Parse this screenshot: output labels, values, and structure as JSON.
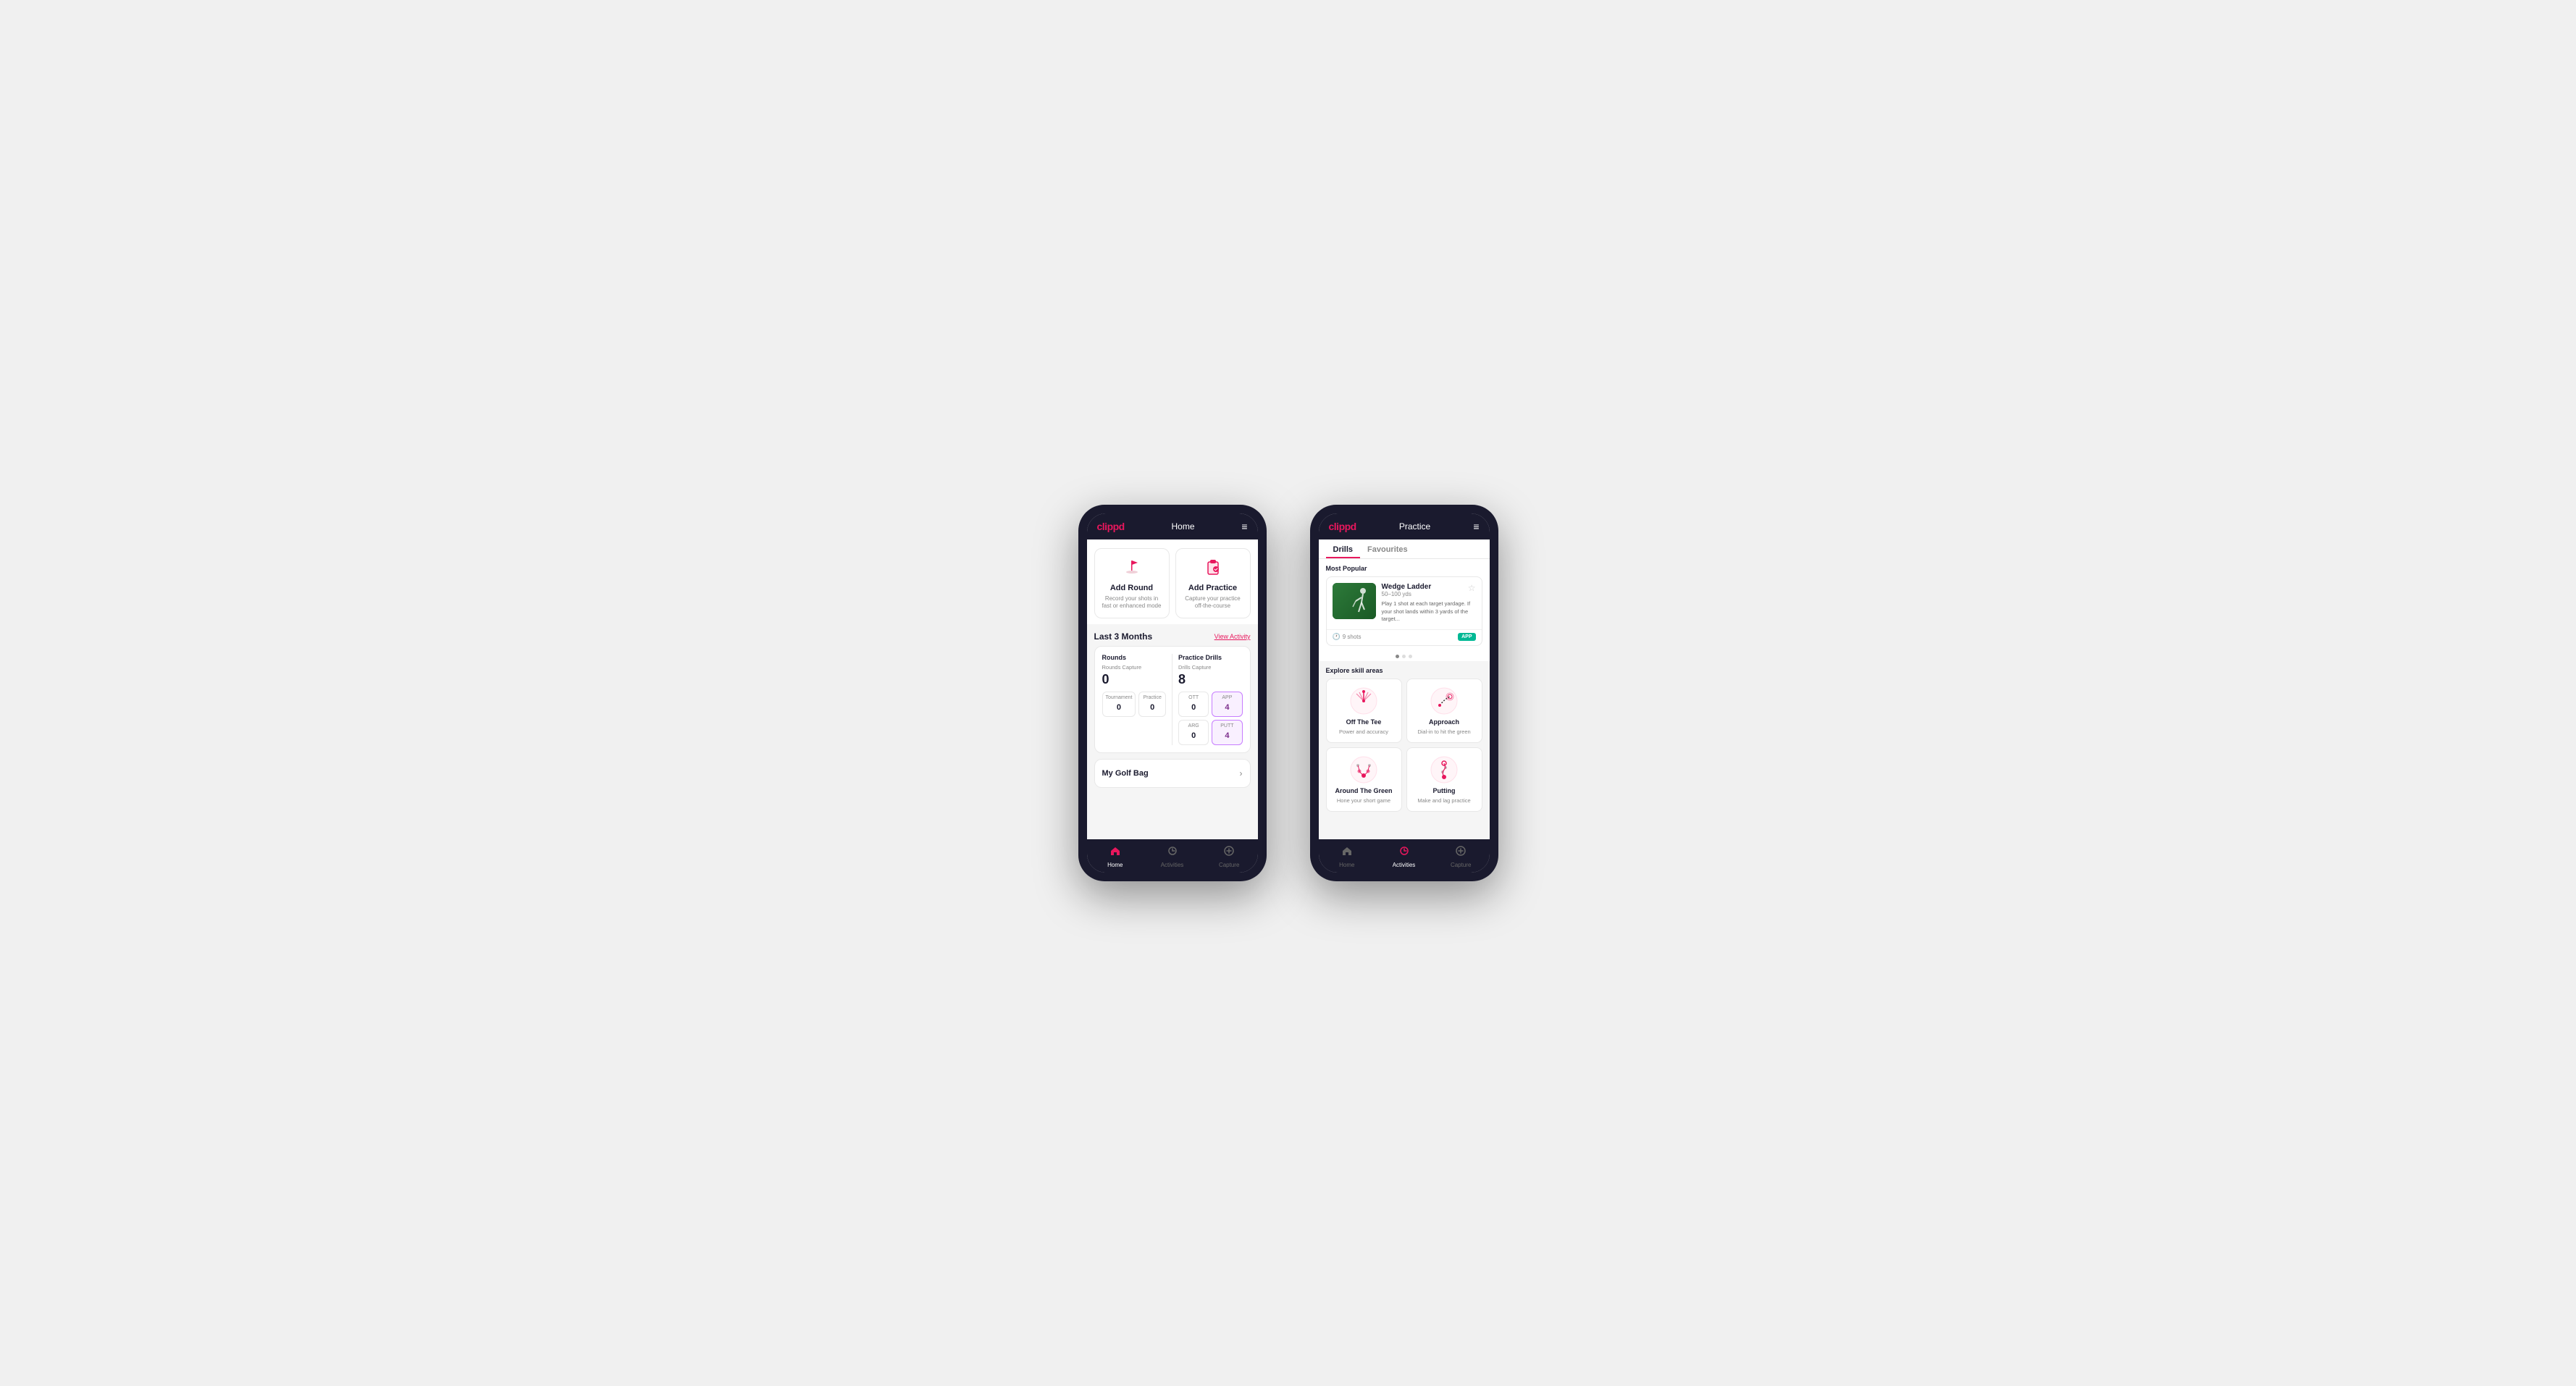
{
  "phone1": {
    "header": {
      "logo": "clippd",
      "title": "Home",
      "menu_icon": "≡"
    },
    "actions": [
      {
        "id": "add-round",
        "title": "Add Round",
        "desc": "Record your shots in fast or enhanced mode",
        "icon": "flag"
      },
      {
        "id": "add-practice",
        "title": "Add Practice",
        "desc": "Capture your practice off-the-course",
        "icon": "clipboard"
      }
    ],
    "activity": {
      "title": "Last 3 Months",
      "link": "View Activity"
    },
    "rounds": {
      "title": "Rounds",
      "capture_label": "Rounds Capture",
      "total": "0",
      "items": [
        {
          "label": "Tournament",
          "value": "0"
        },
        {
          "label": "Practice",
          "value": "0"
        }
      ]
    },
    "practice_drills": {
      "title": "Practice Drills",
      "capture_label": "Drills Capture",
      "total": "8",
      "items": [
        {
          "label": "OTT",
          "value": "0"
        },
        {
          "label": "APP",
          "value": "4",
          "highlighted": true
        },
        {
          "label": "ARG",
          "value": "0"
        },
        {
          "label": "PUTT",
          "value": "4",
          "highlighted": true
        }
      ]
    },
    "golf_bag": {
      "label": "My Golf Bag"
    },
    "nav": [
      {
        "label": "Home",
        "active": true,
        "icon": "🏠"
      },
      {
        "label": "Activities",
        "active": false,
        "icon": "⛳"
      },
      {
        "label": "Capture",
        "active": false,
        "icon": "➕"
      }
    ]
  },
  "phone2": {
    "header": {
      "logo": "clippd",
      "title": "Practice",
      "menu_icon": "≡"
    },
    "tabs": [
      {
        "label": "Drills",
        "active": true
      },
      {
        "label": "Favourites",
        "active": false
      }
    ],
    "most_popular": {
      "label": "Most Popular",
      "drill": {
        "name": "Wedge Ladder",
        "yardage": "50–100 yds",
        "desc": "Play 1 shot at each target yardage. If your shot lands within 3 yards of the target...",
        "shots": "9 shots",
        "badge": "APP"
      },
      "dots": [
        true,
        false,
        false
      ]
    },
    "skill_areas": {
      "label": "Explore skill areas",
      "items": [
        {
          "name": "Off The Tee",
          "desc": "Power and accuracy",
          "icon": "tee"
        },
        {
          "name": "Approach",
          "desc": "Dial-in to hit the green",
          "icon": "approach"
        },
        {
          "name": "Around The Green",
          "desc": "Hone your short game",
          "icon": "around"
        },
        {
          "name": "Putting",
          "desc": "Make and lag practice",
          "icon": "putting"
        }
      ]
    },
    "nav": [
      {
        "label": "Home",
        "active": false,
        "icon": "🏠"
      },
      {
        "label": "Activities",
        "active": true,
        "icon": "⛳"
      },
      {
        "label": "Capture",
        "active": false,
        "icon": "➕"
      }
    ]
  }
}
